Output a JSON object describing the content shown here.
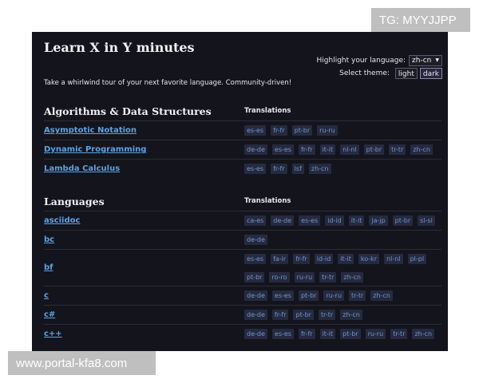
{
  "watermarks": {
    "top": "TG: MYYJJPP",
    "bottom": "www.portal-kfa8.com"
  },
  "header": {
    "title": "Learn X in Y minutes",
    "tagline": "Take a whirlwind tour of your next favorite language. Community-driven!"
  },
  "controls": {
    "highlight_label": "Highlight your language:",
    "highlight_value": "zh-cn",
    "theme_label": "Select theme:",
    "theme_light": "light",
    "theme_dark": "dark"
  },
  "colors": {
    "background": "#14141c",
    "link": "#5aa4e6",
    "tag_bg": "#262a40",
    "tag_text": "#6f95c8"
  },
  "sections": [
    {
      "title": "Algorithms & Data Structures",
      "translations_label": "Translations",
      "rows": [
        {
          "name": "Asymptotic Notation",
          "tags": [
            "es-es",
            "fr-fr",
            "pt-br",
            "ru-ru"
          ]
        },
        {
          "name": "Dynamic Programming",
          "tags": [
            "de-de",
            "es-es",
            "fr-fr",
            "it-it",
            "nl-nl",
            "pt-br",
            "tr-tr",
            "zh-cn"
          ]
        },
        {
          "name": "Lambda Calculus",
          "tags": [
            "es-es",
            "fr-fr",
            "lsf",
            "zh-cn"
          ]
        }
      ]
    },
    {
      "title": "Languages",
      "translations_label": "Translations",
      "rows": [
        {
          "name": "asciidoc",
          "tags": [
            "ca-es",
            "de-de",
            "es-es",
            "id-id",
            "it-it",
            "ja-jp",
            "pt-br",
            "sl-si"
          ]
        },
        {
          "name": "bc",
          "tags": [
            "de-de"
          ]
        },
        {
          "name": "bf",
          "tags": [
            "es-es",
            "fa-ir",
            "fr-fr",
            "id-id",
            "it-it",
            "ko-kr",
            "nl-nl",
            "pl-pl",
            "pt-br",
            "ro-ro",
            "ru-ru",
            "tr-tr",
            "zh-cn"
          ]
        },
        {
          "name": "c",
          "tags": [
            "de-de",
            "es-es",
            "pt-br",
            "ru-ru",
            "tr-tr",
            "zh-cn"
          ]
        },
        {
          "name": "c#",
          "tags": [
            "de-de",
            "fr-fr",
            "pt-br",
            "tr-tr",
            "zh-cn"
          ]
        },
        {
          "name": "c++",
          "tags": [
            "de-de",
            "es-es",
            "fr-fr",
            "it-it",
            "pt-br",
            "ru-ru",
            "tr-tr",
            "zh-cn"
          ]
        }
      ]
    }
  ]
}
